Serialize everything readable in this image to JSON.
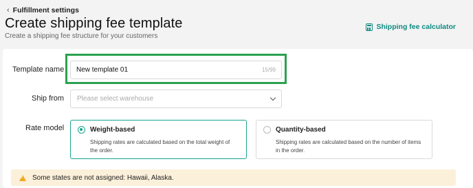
{
  "header": {
    "back_label": "Fulfillment settings",
    "title": "Create shipping fee template",
    "subtitle": "Create a shipping fee structure for your customers",
    "calculator_label": "Shipping fee calculator"
  },
  "form": {
    "template_name": {
      "label": "Template name",
      "value": "New template 01",
      "counter": "15/99"
    },
    "ship_from": {
      "label": "Ship from",
      "placeholder": "Please select warehouse"
    },
    "rate_model": {
      "label": "Rate model",
      "options": [
        {
          "title": "Weight-based",
          "description": "Shipping rates are calculated based on the total weight of the order.",
          "selected": true
        },
        {
          "title": "Quantity-based",
          "description": "Shipping rates are calculated based on the number of items in the order.",
          "selected": false
        }
      ]
    }
  },
  "alert": {
    "text": "Some states are not assigned: Hawaii, Alaska."
  },
  "colors": {
    "accent": "#17a58e",
    "highlight": "#2aa14e",
    "alert_bg": "#fbf0da",
    "warning": "#f0a91c"
  }
}
